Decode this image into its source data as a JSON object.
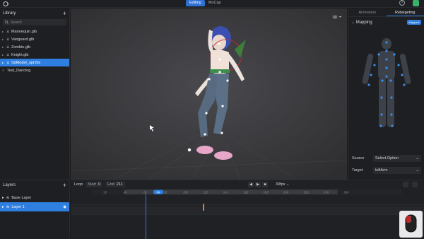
{
  "topbar": {
    "tabs": [
      {
        "label": "Editing",
        "active": true
      },
      {
        "label": "MoCap",
        "active": false
      }
    ],
    "help_label": "?"
  },
  "library": {
    "title": "Library",
    "search_placeholder": "Search",
    "items": [
      {
        "label": "Mannequin.glb",
        "selected": false
      },
      {
        "label": "Vanguard.glb",
        "selected": false
      },
      {
        "label": "Zombie.glb",
        "selected": false
      },
      {
        "label": "Knight.glb",
        "selected": false
      },
      {
        "label": "SdModel_opt.fbx",
        "selected": true
      },
      {
        "label": "Test_Dancing",
        "selected": false
      }
    ]
  },
  "right_panel": {
    "tabs": [
      {
        "label": "Animation",
        "active": false
      },
      {
        "label": "Retargeting",
        "active": true
      }
    ],
    "mapping_title": "Mapping",
    "mapping_toggle": "Mapped",
    "source_label": "Source",
    "source_value": "Select Option",
    "target_label": "Target",
    "target_value": "leftArm"
  },
  "layers": {
    "title": "Layers",
    "items": [
      {
        "label": "Base Layer",
        "selected": false
      },
      {
        "label": "Layer 1",
        "selected": true
      }
    ]
  },
  "timeline": {
    "loop_label": "Loop",
    "start_label": "Start",
    "start_value": "0",
    "end_label": "End",
    "end_value": "211",
    "fps_label": "30fps",
    "current_frame": "84",
    "ruler_ticks": [
      "20",
      "40",
      "60",
      "80",
      "100",
      "120",
      "140",
      "160",
      "180",
      "200",
      "220",
      "240",
      "260"
    ]
  },
  "colors": {
    "accent": "#2f7fe0",
    "keyframe": "#e8793a",
    "joint": "#3b8fe8",
    "user_badge": "#39b36a"
  }
}
